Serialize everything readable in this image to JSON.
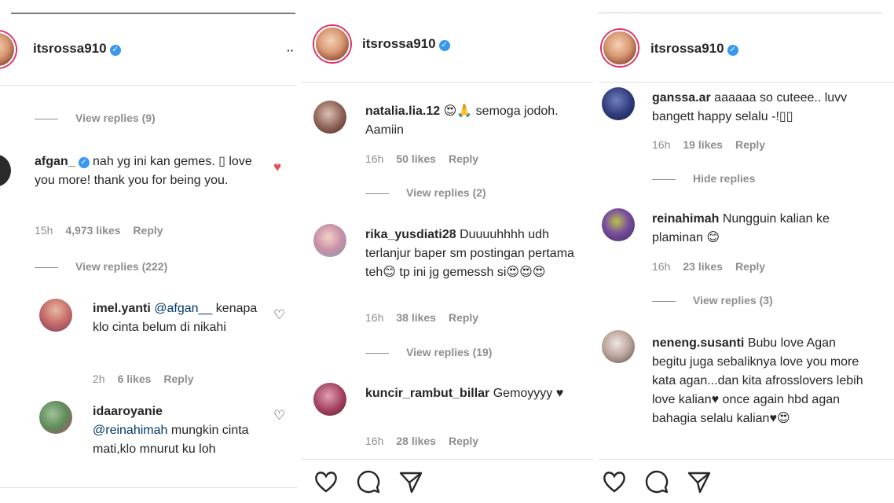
{
  "panels": [
    {
      "username": "itsrossa910",
      "comments": [
        {
          "user": "afgan_",
          "verified": true,
          "text": "nah yg ini kan gemes. ▯ love you more! thank you for being you.",
          "time": "15h",
          "likes": "4,973 likes",
          "reply": "Reply",
          "liked": true
        },
        {
          "user": "imel.yanti",
          "mention": "@afgan__",
          "text": "kenapa klo cinta belum di nikahi",
          "time": "2h",
          "likes": "6 likes",
          "reply": "Reply"
        },
        {
          "user": "idaaroyanie",
          "mention": "@reinahimah",
          "text": "mungkin cinta mati,klo mnurut ku loh"
        }
      ],
      "view_replies": [
        "View replies (9)",
        "View replies (222)"
      ]
    },
    {
      "username": "itsrossa910",
      "comments": [
        {
          "user": "natalia.lia.12",
          "text": "😍🙏 semoga jodoh. Aamiin",
          "time": "16h",
          "likes": "50 likes",
          "reply": "Reply"
        },
        {
          "user": "rika_yusdiati28",
          "text": "Duuuuhhhh udh terlanjur baper sm postingan pertama teh😊 tp ini jg gemessh si😍😍😍",
          "time": "16h",
          "likes": "38 likes",
          "reply": "Reply"
        },
        {
          "user": "kuncir_rambut_billar",
          "text": "Gemoyyyy ♥",
          "time": "16h",
          "likes": "28 likes",
          "reply": "Reply"
        }
      ],
      "view_replies": [
        "View replies (2)",
        "View replies (19)"
      ]
    },
    {
      "username": "itsrossa910",
      "comments": [
        {
          "user": "ganssa.ar",
          "text": "aaaaaa so cuteee.. luvv bangett happy selalu -!▯▯",
          "time": "16h",
          "likes": "19 likes",
          "reply": "Reply"
        },
        {
          "user": "reinahimah",
          "text": "Nungguin kalian ke plaminan 😊",
          "time": "16h",
          "likes": "23 likes",
          "reply": "Reply"
        },
        {
          "user": "neneng.susanti",
          "text": "Bubu love Agan begitu juga sebaliknya love you more kata agan...dan kita afrosslovers lebih love kalian♥ once again hbd agan bahagia selalu kalian♥😍"
        }
      ],
      "hide_replies": "Hide replies",
      "view_replies": [
        "View replies (3)"
      ]
    }
  ],
  "colors": {
    "verified": "#3897f0",
    "heart_liked": "#ed4956",
    "story_ring": "#e1306c",
    "muted": "#8e8e8e"
  }
}
